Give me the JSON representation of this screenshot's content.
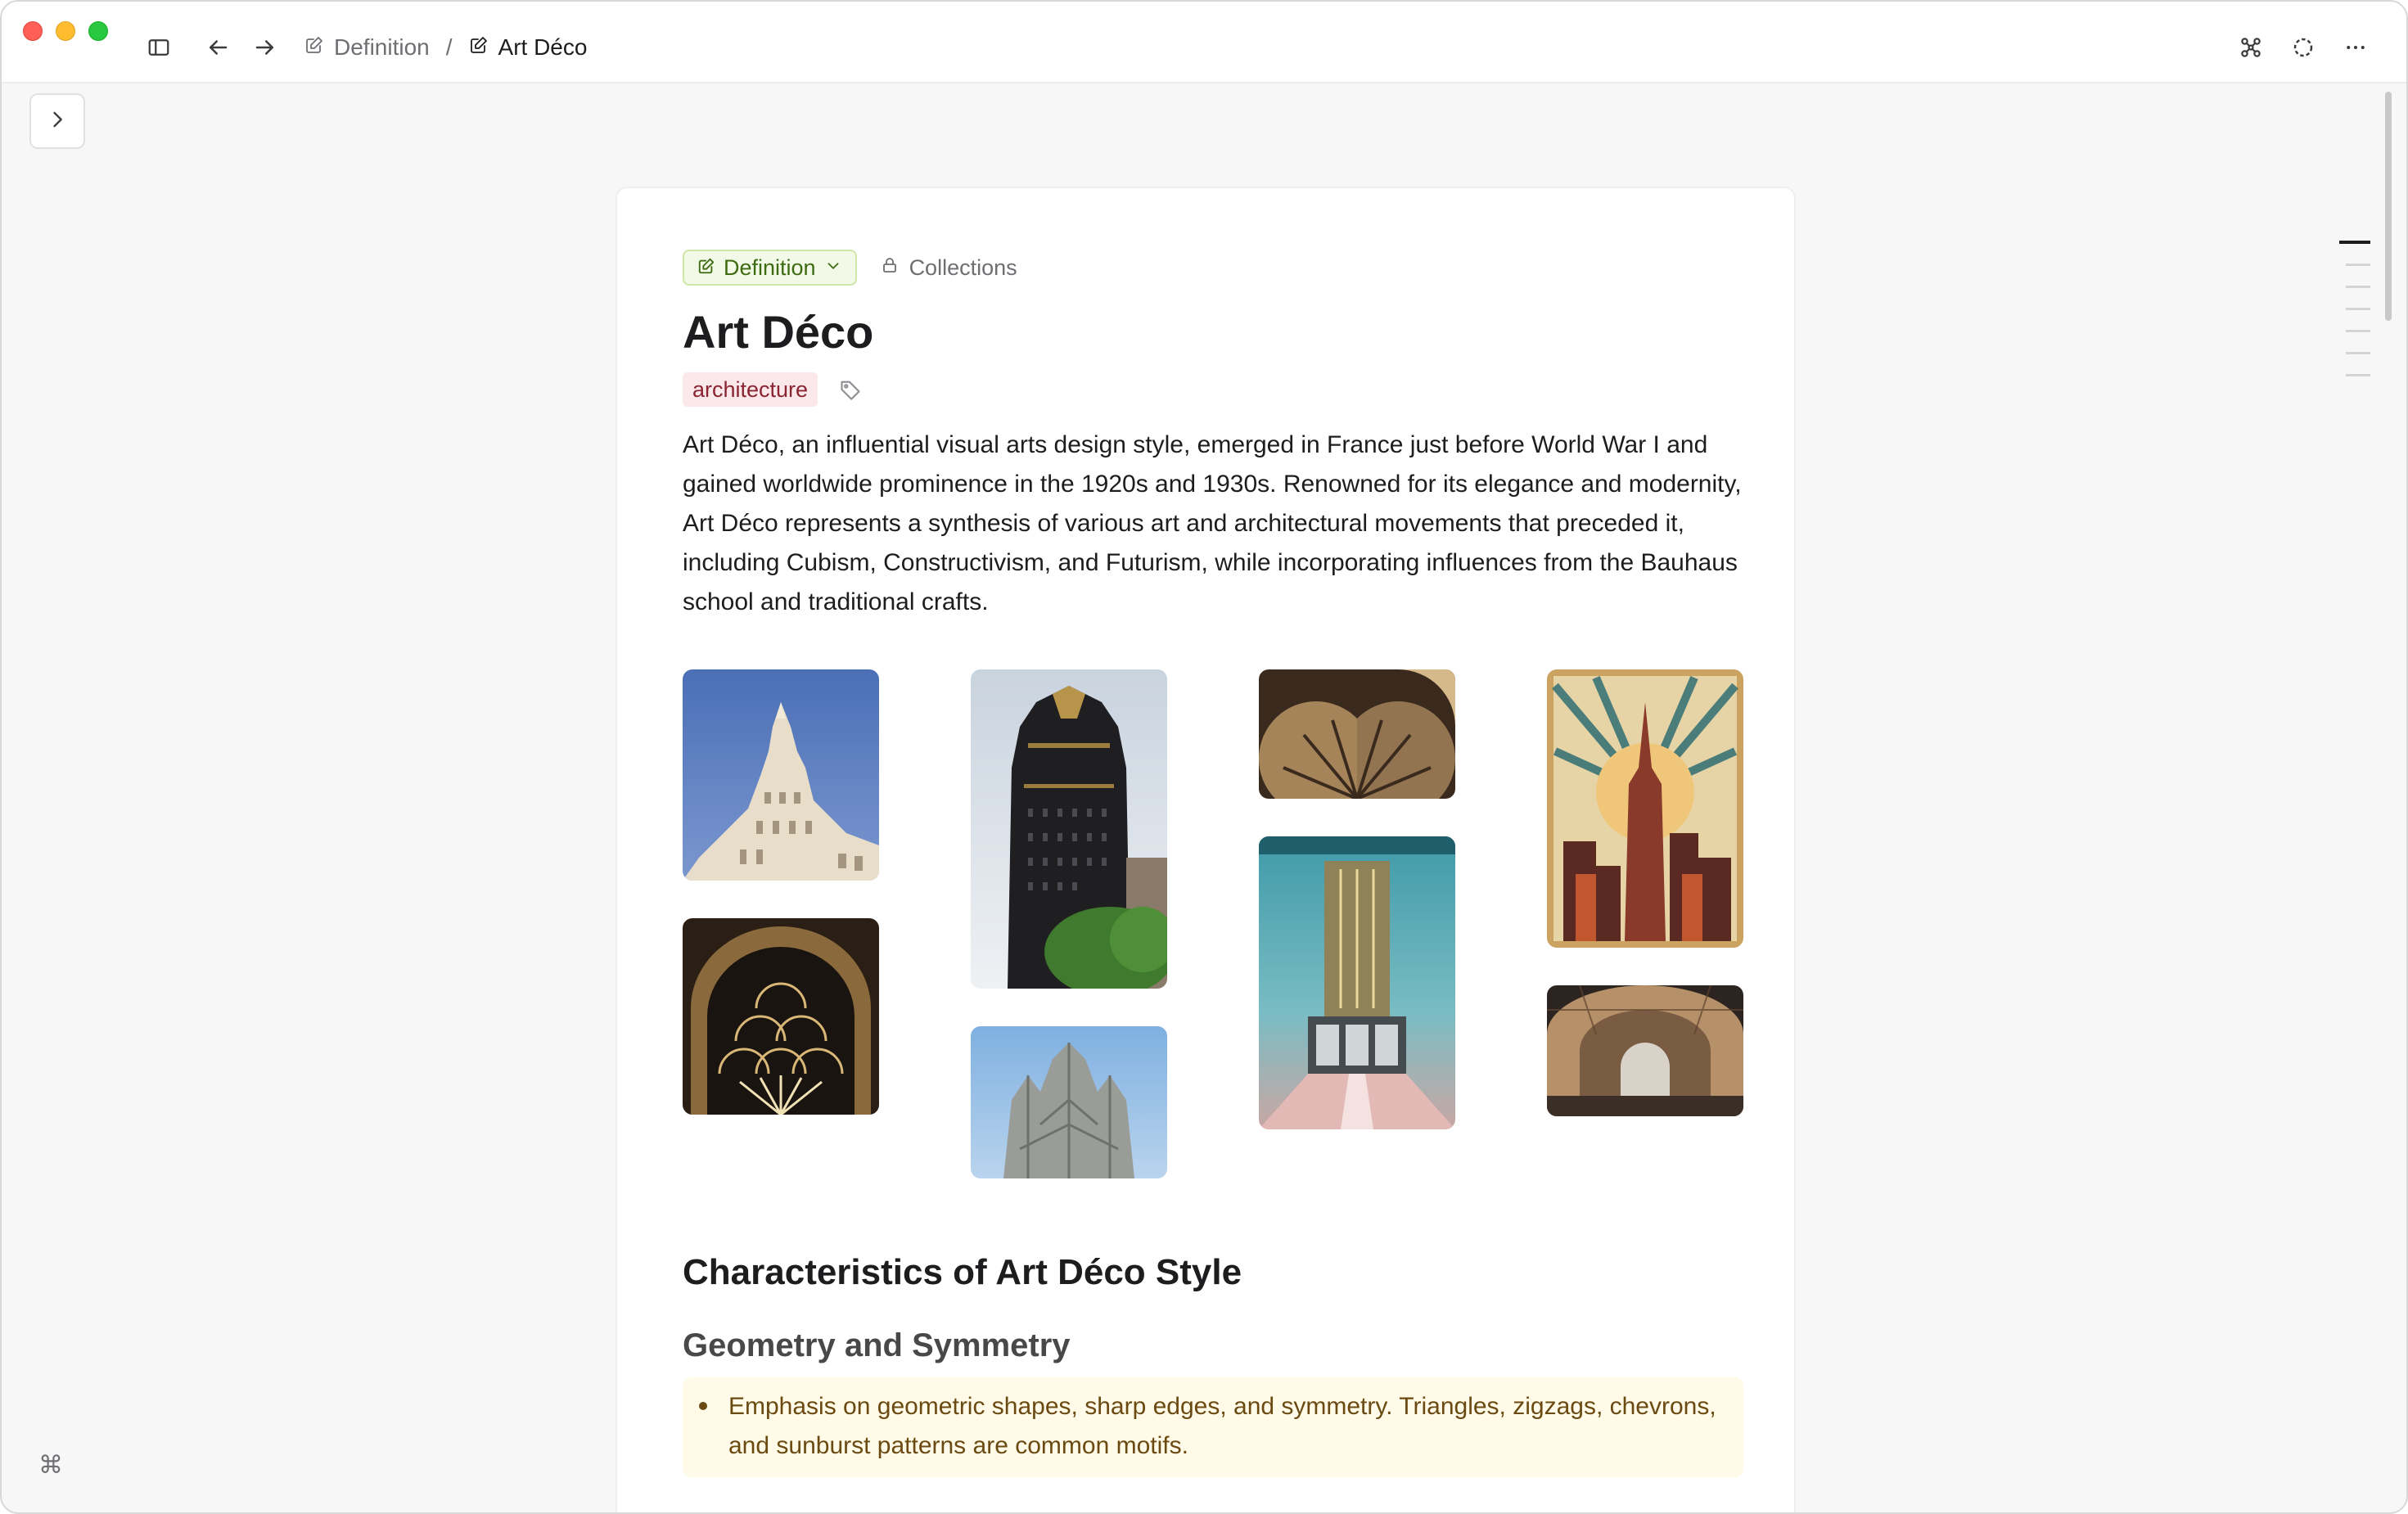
{
  "breadcrumbs": [
    {
      "label": "Definition"
    },
    {
      "label": "Art Déco"
    }
  ],
  "breadcrumb_separator": "/",
  "shortcut_glyph": "⌘",
  "page": {
    "type_label": "Definition",
    "collections_label": "Collections",
    "title": "Art Déco",
    "tag": "architecture",
    "intro": "Art Déco, an influential visual arts design style, emerged in France just before World War I and gained worldwide prominence in the 1920s and 1930s. Renowned for its elegance and modernity, Art Déco represents a synthesis of various art and architectural movements that preceded it, including Cubism, Constructivism, and Futurism, while incorporating influences from the Bauhaus school and traditional crafts.",
    "section_heading": "Characteristics of Art Déco Style",
    "subsection_heading": "Geometry and Symmetry",
    "bullet": "Emphasis on geometric shapes, sharp edges, and symmetry. Triangles, zigzags, chevrons, and sunburst patterns are common motifs."
  },
  "gallery_images": [
    {
      "name": "ornate-tower-photo"
    },
    {
      "name": "skyscraper-photo"
    },
    {
      "name": "fan-ornament-photo"
    },
    {
      "name": "skyline-poster-illustration"
    },
    {
      "name": "arched-fan-window-photo"
    },
    {
      "name": "lobby-interior-photo"
    },
    {
      "name": "gothic-spire-photo"
    },
    {
      "name": "vaulted-hall-photo"
    }
  ],
  "colors": {
    "accent_green": "#3d6b12",
    "tag_bg": "#fbe8ea",
    "callout_bg": "#fffbe8"
  }
}
